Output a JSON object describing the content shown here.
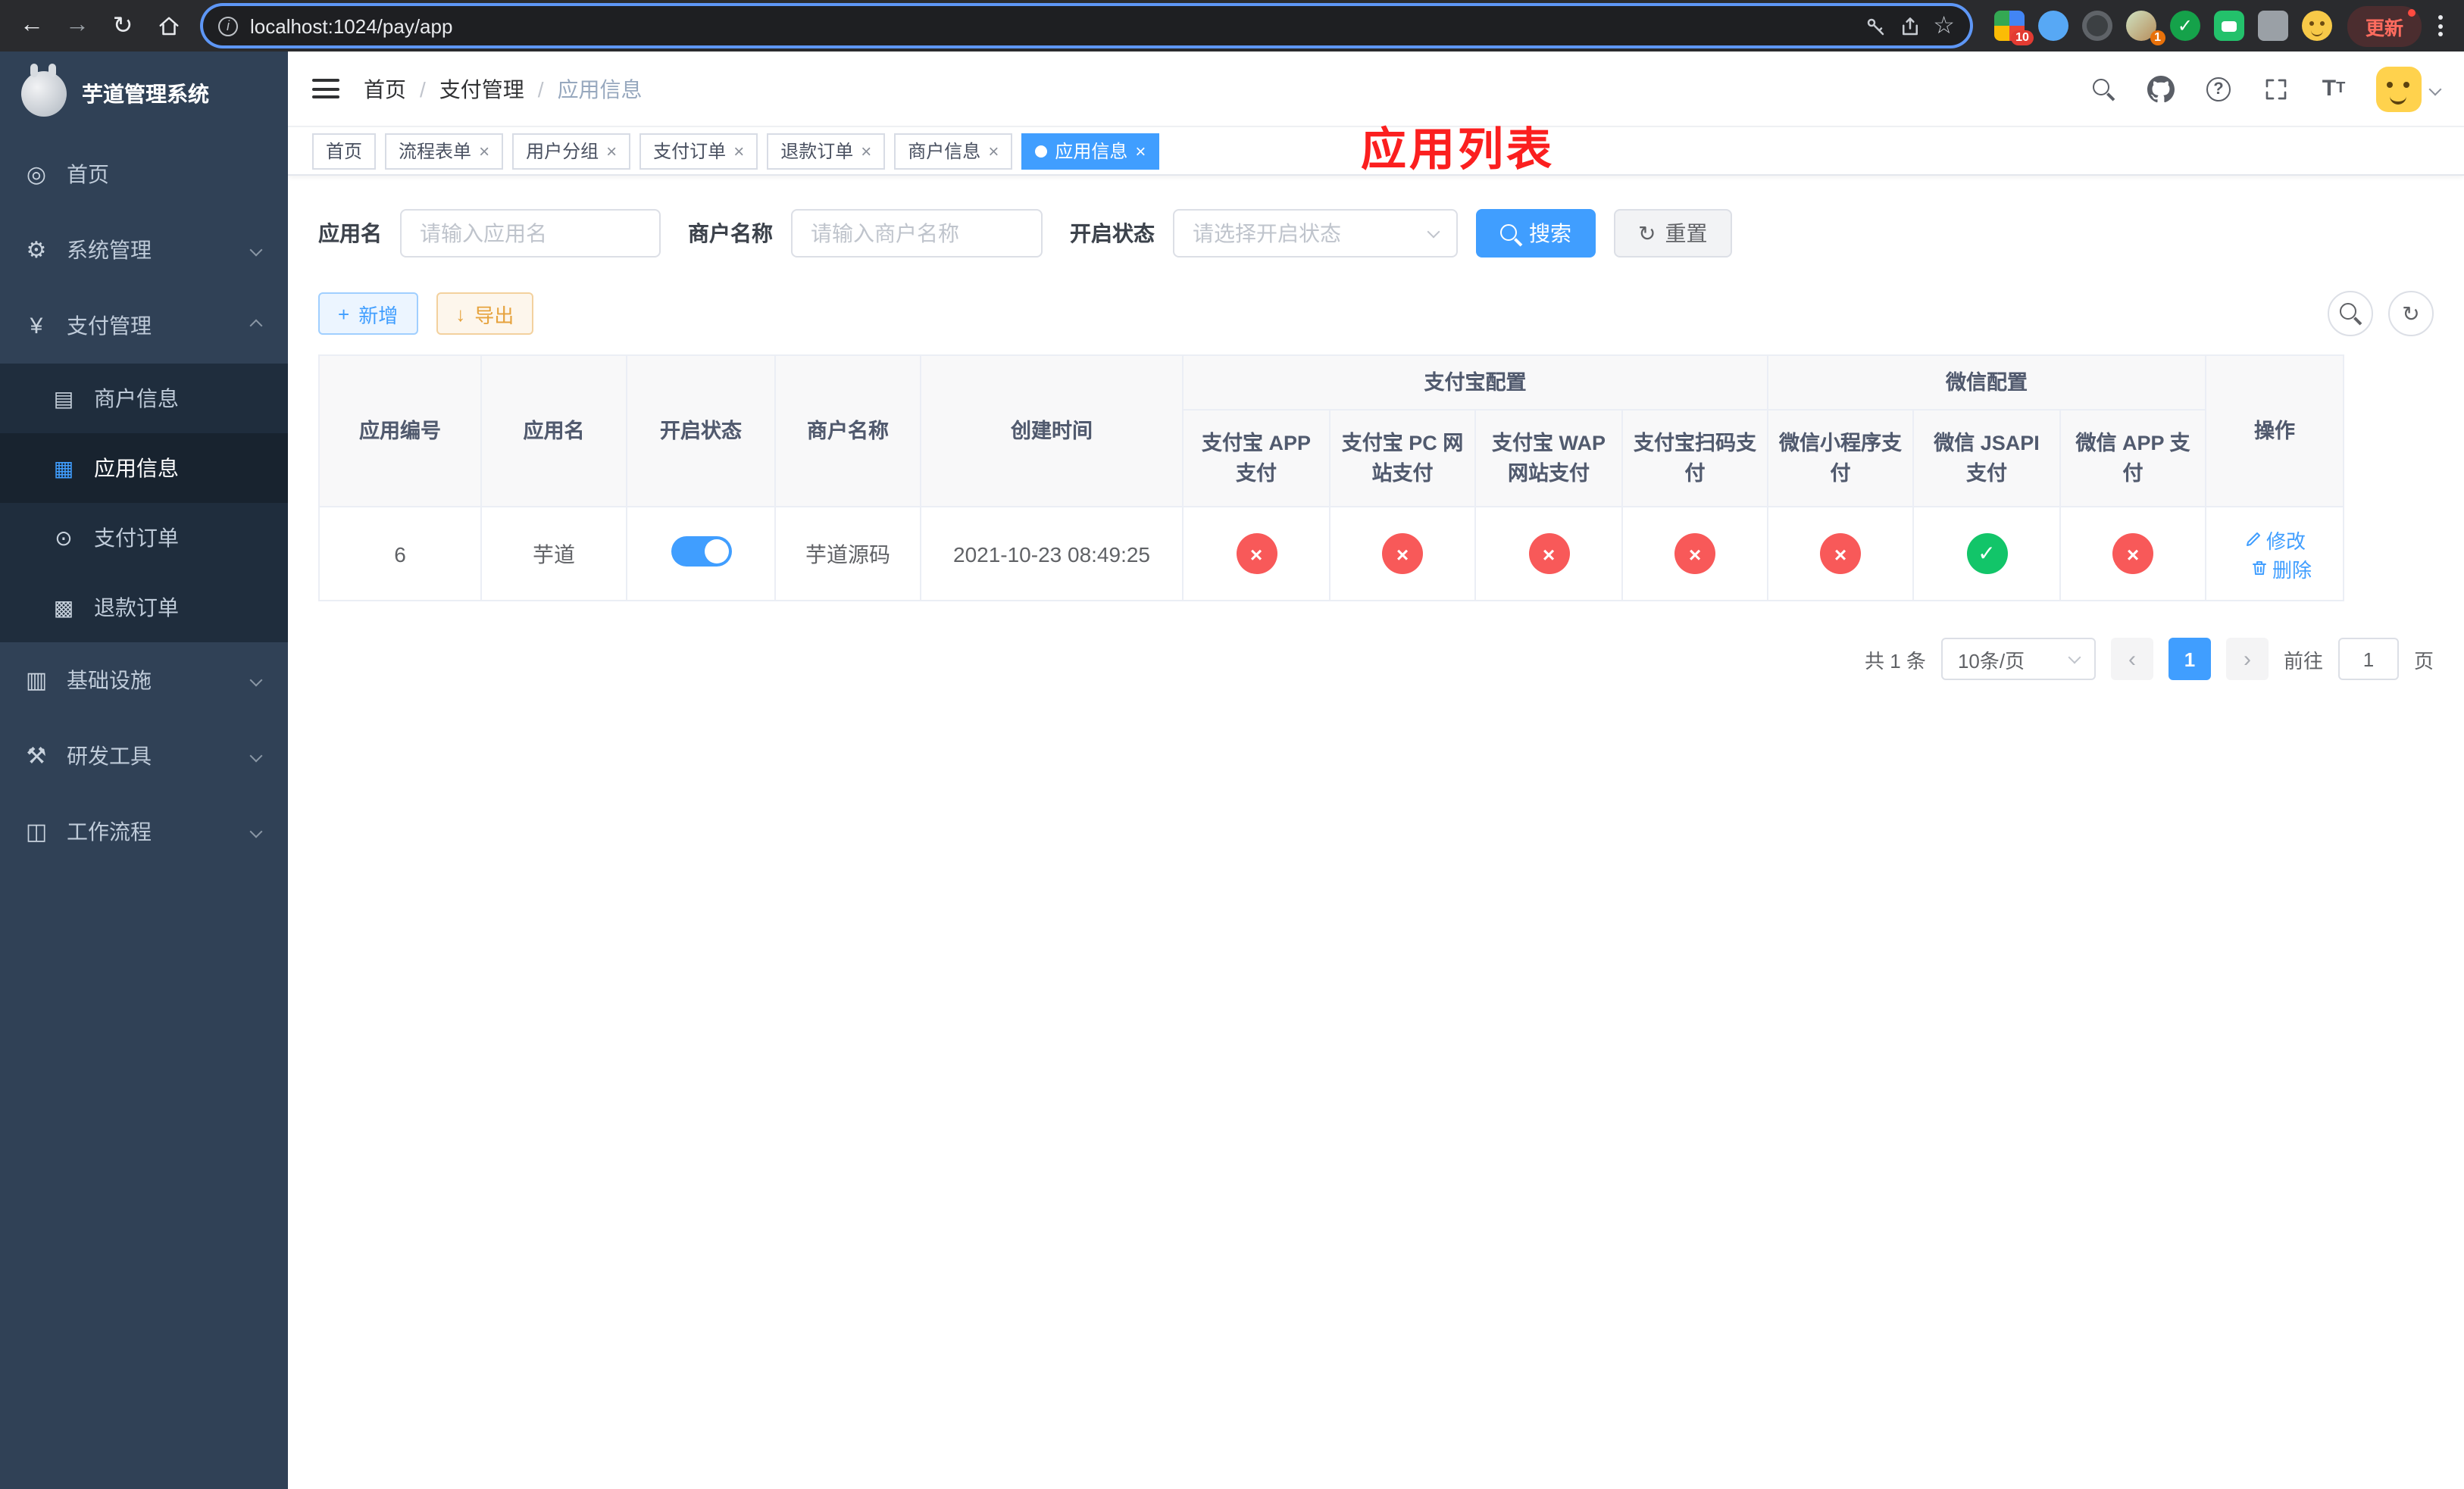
{
  "browser": {
    "url": "localhost:1024/pay/app",
    "update_label": "更新",
    "extension_badge_grid": "10",
    "extension_badge_avatar": "1"
  },
  "sidebar": {
    "title": "芋道管理系统",
    "items": {
      "home": "首页",
      "system": "系统管理",
      "payment": "支付管理",
      "infra": "基础设施",
      "dev_tools": "研发工具",
      "workflow": "工作流程"
    },
    "submenu": {
      "merchant": "商户信息",
      "app": "应用信息",
      "pay_order": "支付订单",
      "refund_order": "退款订单"
    },
    "icons": [
      "dashboard-icon",
      "gear-icon",
      "yen-icon",
      "server-icon",
      "tools-icon",
      "workflow-icon",
      "card-icon",
      "grid-icon",
      "order-icon",
      "refund-icon"
    ]
  },
  "header": {
    "breadcrumb": {
      "home": "首页",
      "section": "支付管理",
      "current": "应用信息"
    },
    "separator": "/",
    "overlay_title": "应用列表",
    "icons": [
      "search",
      "github",
      "help",
      "fullscreen",
      "font-size",
      "avatar"
    ]
  },
  "tags": [
    {
      "label": "首页"
    },
    {
      "label": "流程表单"
    },
    {
      "label": "用户分组"
    },
    {
      "label": "支付订单"
    },
    {
      "label": "退款订单"
    },
    {
      "label": "商户信息"
    },
    {
      "label": "应用信息"
    }
  ],
  "filters": {
    "app_name_label": "应用名",
    "app_name_placeholder": "请输入应用名",
    "merchant_label": "商户名称",
    "merchant_placeholder": "请输入商户名称",
    "status_label": "开启状态",
    "status_placeholder": "请选择开启状态",
    "search_label": "搜索",
    "reset_label": "重置"
  },
  "toolbar": {
    "add_label": "新增",
    "export_label": "导出"
  },
  "table": {
    "col_id": "应用编号",
    "col_name": "应用名",
    "col_status": "开启状态",
    "col_merchant": "商户名称",
    "col_created": "创建时间",
    "group_alipay": "支付宝配置",
    "group_wechat": "微信配置",
    "col_op": "操作",
    "sub": [
      "支付宝 APP 支付",
      "支付宝 PC 网站支付",
      "支付宝 WAP 网站支付",
      "支付宝扫码支付",
      "微信小程序支付",
      "微信 JSAPI 支付",
      "微信 APP 支付"
    ],
    "rows": [
      {
        "id": "6",
        "name": "芋道",
        "enabled": true,
        "merchant": "芋道源码",
        "created": "2021-10-23 08:49:25",
        "configs": [
          "no",
          "no",
          "no",
          "no",
          "no",
          "yes",
          "no"
        ],
        "edit_label": "修改",
        "delete_label": "删除"
      }
    ]
  },
  "pagination": {
    "total": "共 1 条",
    "page_size": "10条/页",
    "page": "1",
    "goto_label": "前往",
    "goto_value": "1",
    "page_unit": "页"
  }
}
